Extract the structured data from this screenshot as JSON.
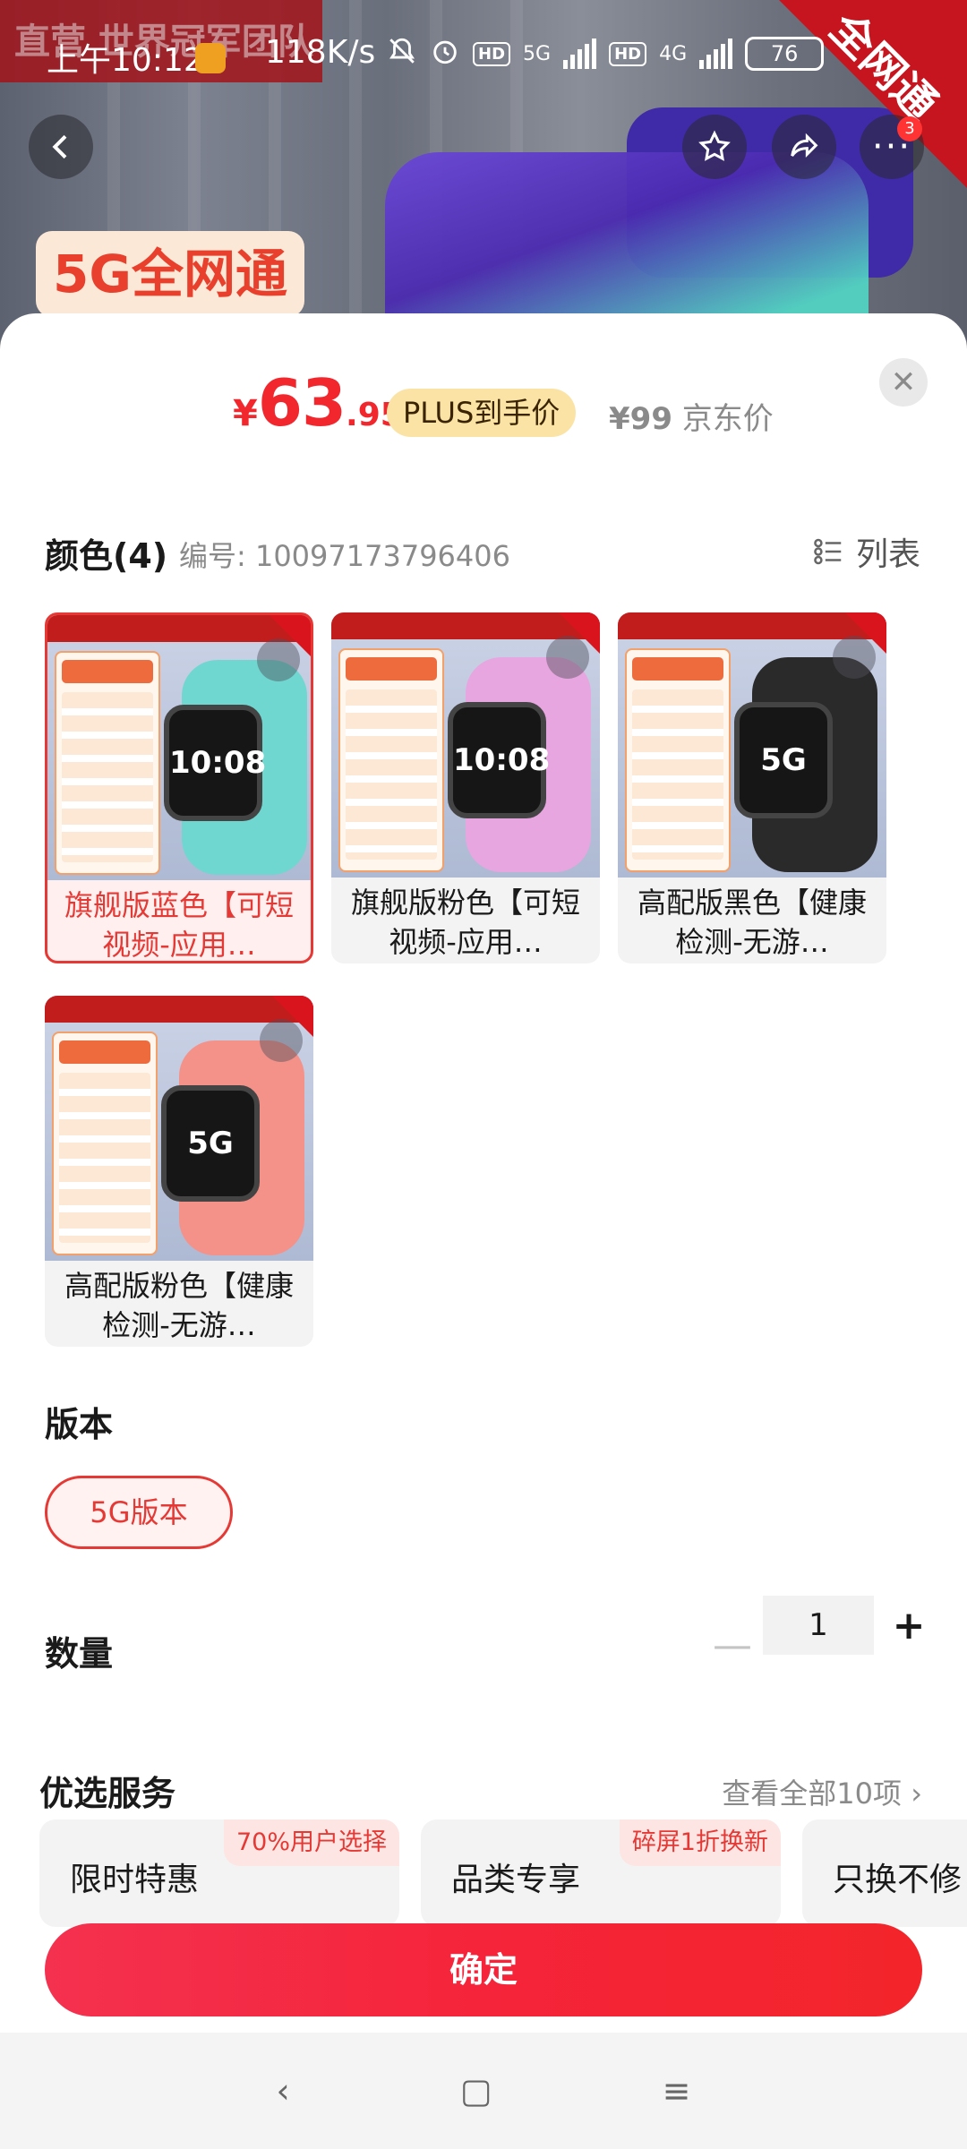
{
  "status_bar": {
    "time": "上午10:12",
    "net_speed": "118K/s",
    "sim1_type": "5G",
    "sim2_type": "4G",
    "hd_label": "HD",
    "battery": "76"
  },
  "background": {
    "promo_text": "5G全网通",
    "corner_text": "全网通",
    "brand_banner": "直营 世界冠军团队"
  },
  "top_actions": {
    "more_badge": "3"
  },
  "price": {
    "currency": "¥",
    "integer": "63",
    "decimal": ".95",
    "plus_tag": "PLUS到手价",
    "jd_price": "¥99",
    "jd_label": "京东价"
  },
  "color_section": {
    "title": "颜色(4)",
    "code": "编号: 10097173796406",
    "list_label": "列表",
    "items": [
      {
        "label": "旗舰版蓝色【可短视频-应用…",
        "face": "10:08",
        "selected": true,
        "band_color": "#6fd7d0"
      },
      {
        "label": "旗舰版粉色【可短视频-应用…",
        "face": "10:08",
        "selected": false,
        "band_color": "#e7a6df"
      },
      {
        "label": "高配版黑色【健康检测-无游…",
        "face": "5G",
        "selected": false,
        "band_color": "#2a2a2a"
      },
      {
        "label": "高配版粉色【健康检测-无游…",
        "face": "5G",
        "selected": false,
        "band_color": "#f4928a"
      }
    ]
  },
  "version_section": {
    "title": "版本",
    "option": "5G版本"
  },
  "quantity_section": {
    "title": "数量",
    "minus": "—",
    "value": "1",
    "plus": "+"
  },
  "service_section": {
    "title": "优选服务",
    "view_all": "查看全部10项 ›",
    "items": [
      {
        "title": "限时特惠",
        "tag": "70%用户选择"
      },
      {
        "title": "品类专享",
        "tag": "碎屏1折换新"
      },
      {
        "title": "只换不修",
        "tag": ""
      }
    ]
  },
  "confirm_label": "确定",
  "nav": {
    "back": "‹",
    "home": "▢",
    "menu": "≡"
  },
  "colors": {
    "accent": "#f2272d",
    "plus_bg": "#fbe3a5"
  }
}
